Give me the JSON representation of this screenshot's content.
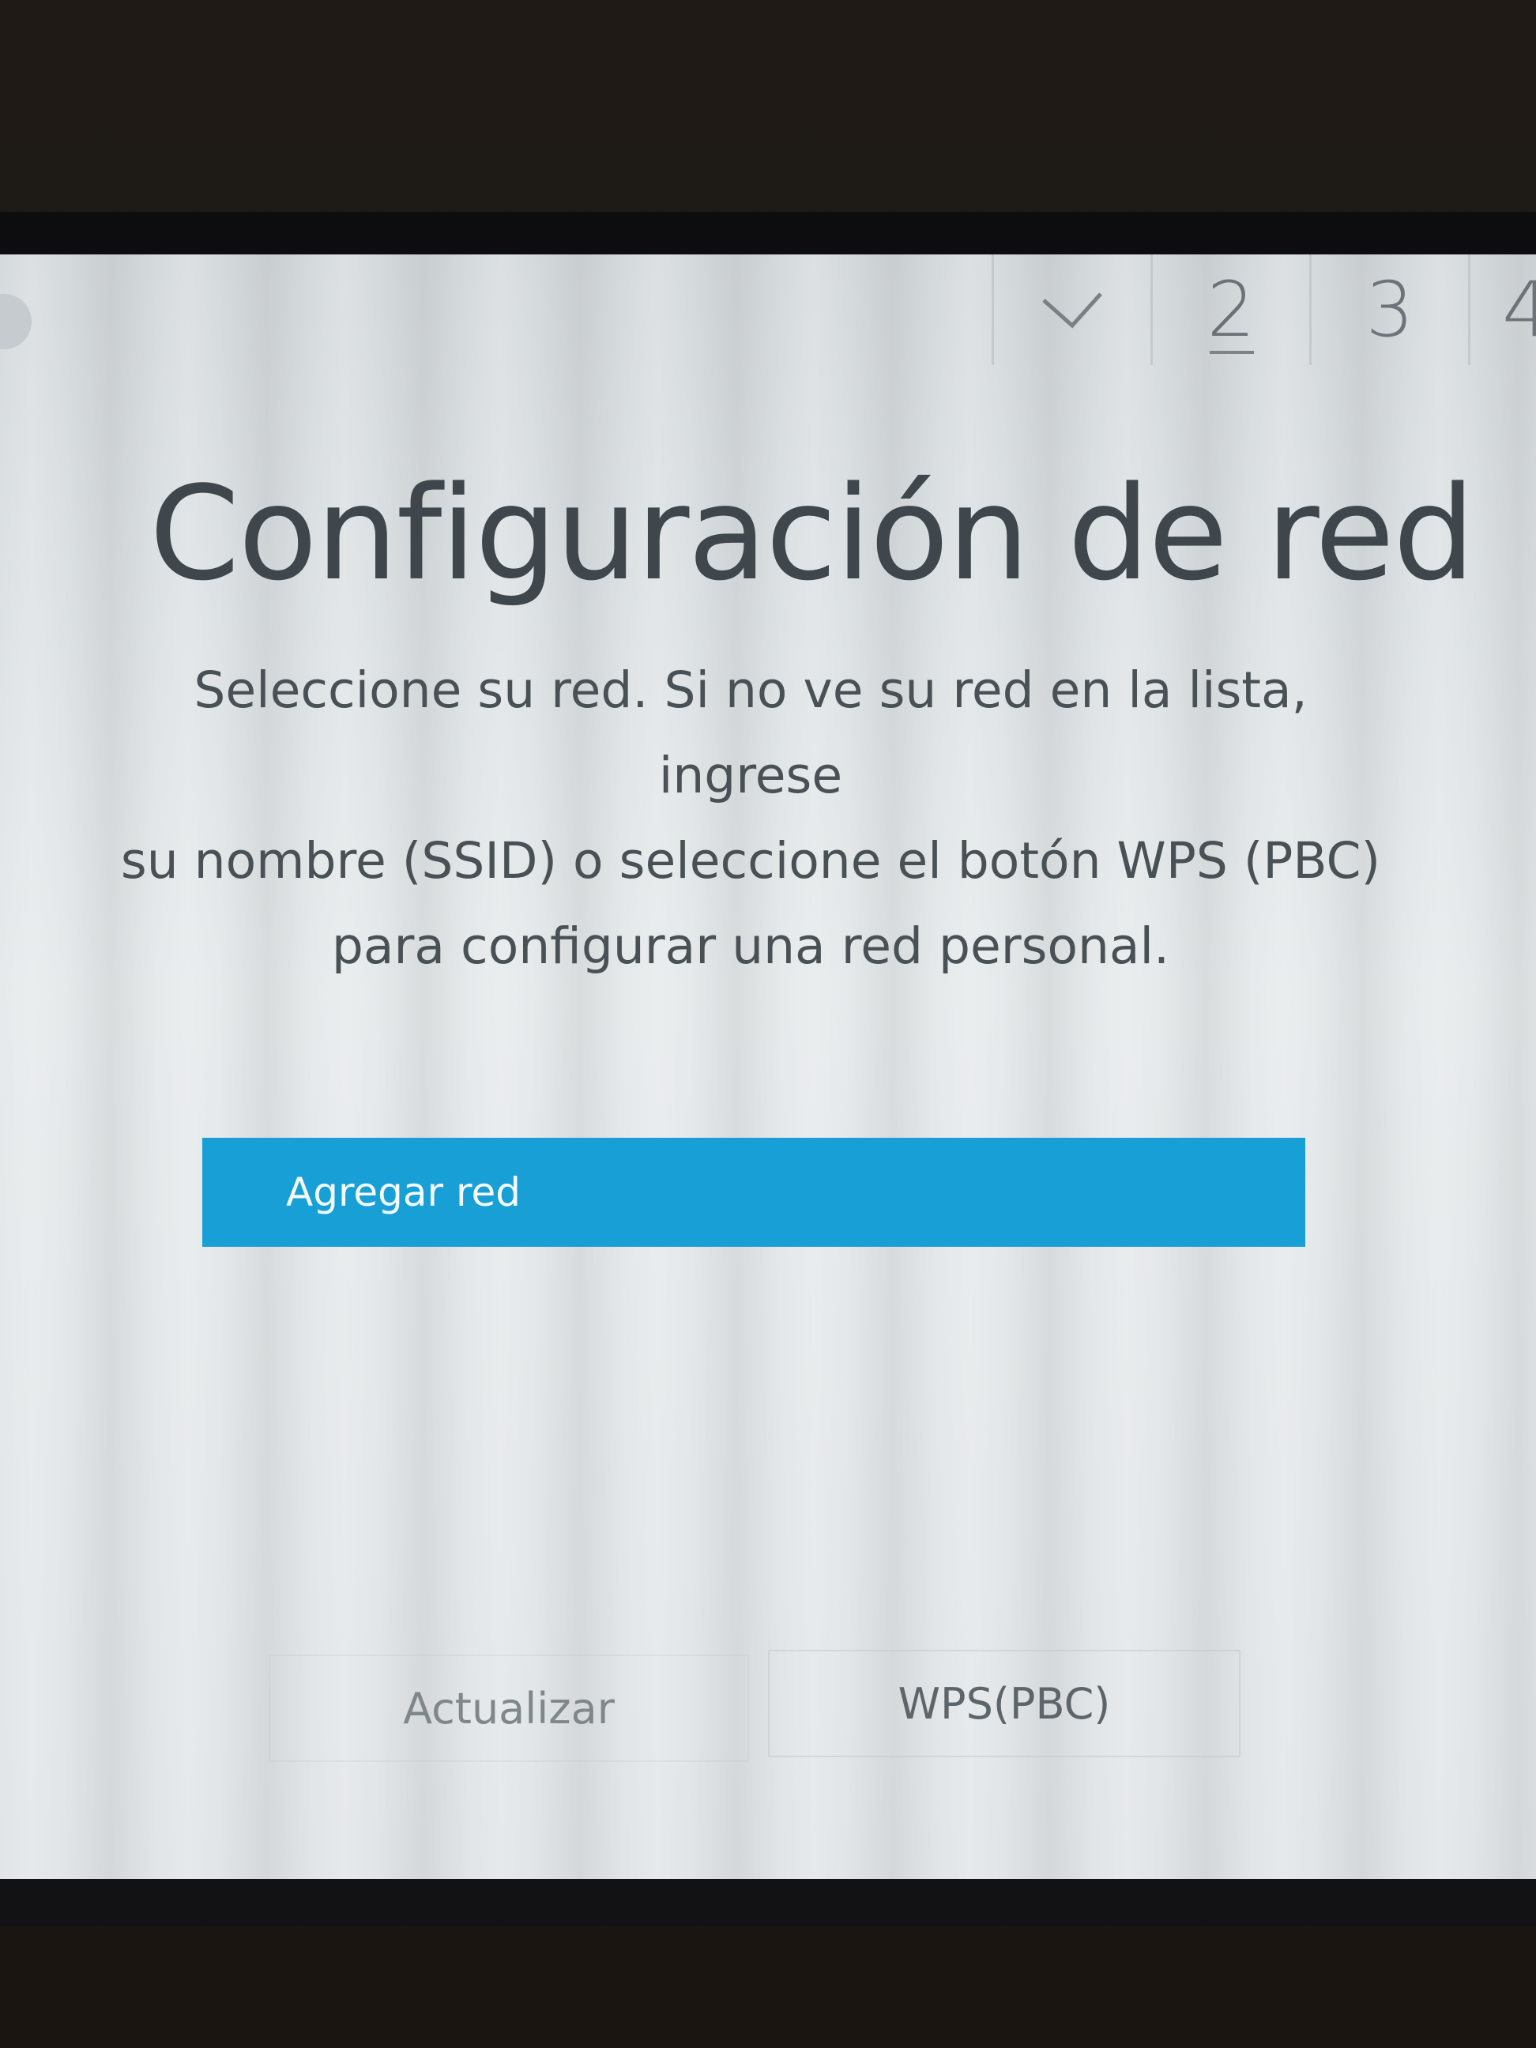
{
  "progress": {
    "steps": [
      {
        "label": "",
        "icon": "check-icon",
        "state": "done"
      },
      {
        "label": "2",
        "state": "current"
      },
      {
        "label": "3",
        "state": "upcoming"
      },
      {
        "label": "4",
        "state": "upcoming"
      }
    ]
  },
  "title": "Configuración de red",
  "description": "Seleccione su red. Si no ve su red en la lista, ingrese\nsu nombre (SSID) o seleccione el botón WPS (PBC)\npara configurar una red personal.",
  "network_list": {
    "items": [
      {
        "label": "Agregar red",
        "selected": true
      }
    ]
  },
  "actions": {
    "refresh_label": "Actualizar",
    "wps_label": "WPS(PBC)"
  },
  "colors": {
    "accent": "#189fd6",
    "title_text": "#3f464c",
    "body_text": "#4a5156",
    "screen_bg": "#e2e6e8"
  }
}
